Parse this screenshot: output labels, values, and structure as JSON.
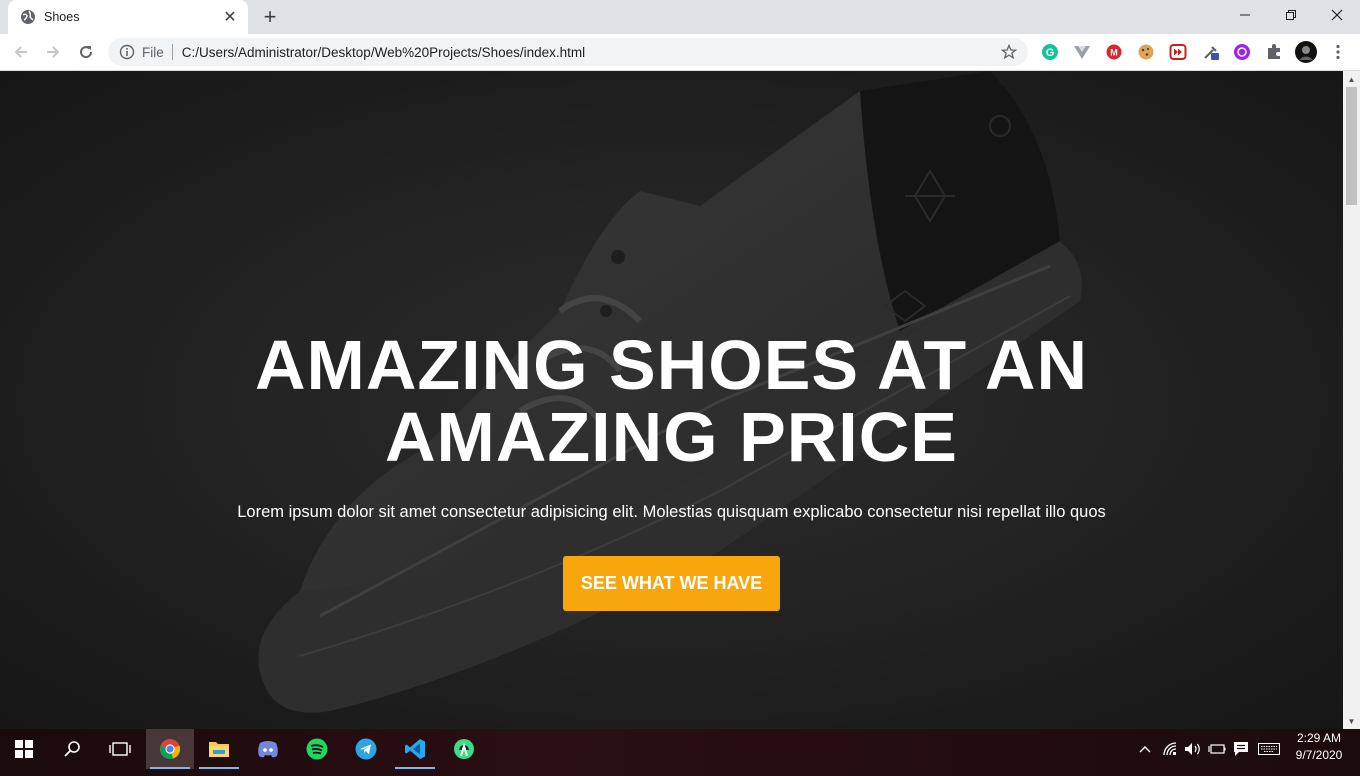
{
  "browser": {
    "tab_title": "Shoes",
    "new_tab_label": "+",
    "address_scheme_label": "File",
    "address_url": "C:/Users/Administrator/Desktop/Web%20Projects/Shoes/index.html"
  },
  "page": {
    "hero_title": "AMAZING SHOES AT AN AMAZING PRICE",
    "hero_subtitle": "Lorem ipsum dolor sit amet consectetur adipisicing elit. Molestias quisquam explicabo consectetur nisi repellat illo quos",
    "cta_label": "SEE WHAT WE HAVE",
    "accent_color": "#f7a60e"
  },
  "extensions": [
    "grammarly-icon",
    "vue-devtools-icon",
    "mega-icon",
    "cookie-icon",
    "video-speed-icon",
    "eyedropper-icon",
    "vpn-icon",
    "extensions-puzzle-icon",
    "profile-avatar"
  ],
  "taskbar": {
    "apps": [
      "chrome",
      "file-explorer",
      "discord",
      "spotify",
      "telegram",
      "vscode",
      "android-studio"
    ],
    "time": "2:29 AM",
    "date": "9/7/2020"
  }
}
